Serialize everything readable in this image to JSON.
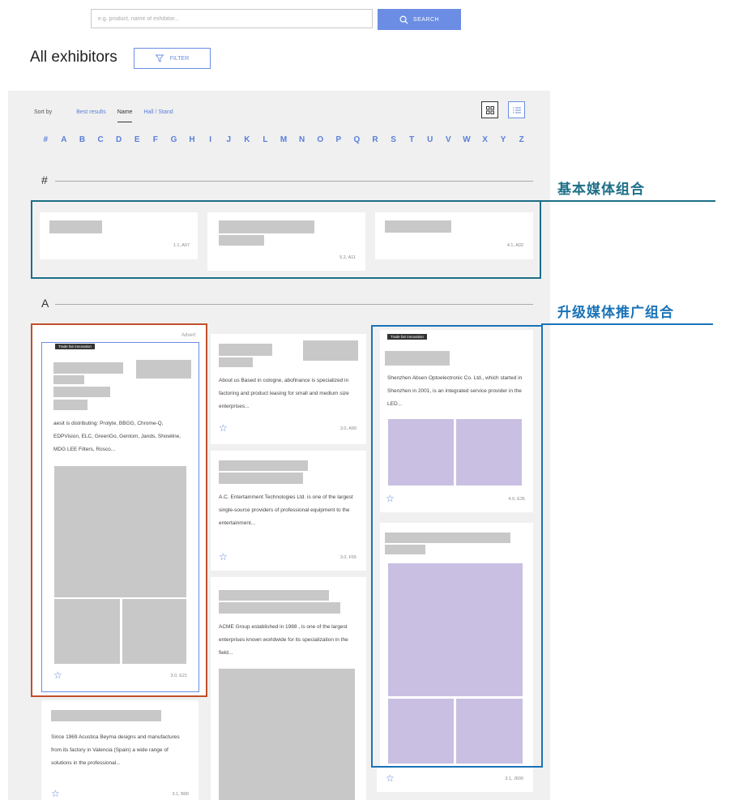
{
  "search": {
    "placeholder": "e.g. product, name of exhibitor...",
    "button_label": "SEARCH"
  },
  "header": {
    "title": "All exhibitors",
    "filter_label": "FILTER"
  },
  "sort": {
    "label": "Sort by",
    "options": [
      "Best results",
      "Name",
      "Hall / Stand"
    ],
    "active": "Name"
  },
  "alphabet": [
    "#",
    "A",
    "B",
    "C",
    "D",
    "E",
    "F",
    "G",
    "H",
    "I",
    "J",
    "K",
    "L",
    "M",
    "N",
    "O",
    "P",
    "Q",
    "R",
    "S",
    "T",
    "U",
    "V",
    "W",
    "X",
    "Y",
    "Z"
  ],
  "sections": {
    "hash": "#",
    "a": "A"
  },
  "annotations": {
    "basic": "基本媒体组合",
    "upgraded": "升级媒体推广组合"
  },
  "hash_cards": [
    {
      "code": "1.1, A07"
    },
    {
      "code": "5.2, A11"
    },
    {
      "code": "4.1, A02"
    }
  ],
  "a_cards": {
    "advert_label": "Advert",
    "tag_label": "Trade fair innovation",
    "card1_desc": "aesit is distributing: Prolyte, BBGG, Chrome-Q, EDPVision, ELC, GreenGo, Gentom, Jands, Showline, MDG LEE Filters, Rosco...",
    "card1_code": "3.0, E21",
    "card2_desc": "About us Based in cologne, abofinance is specialized in factoring and product leasing for small and medium size enterprises...",
    "card2_code": "3.0, A90",
    "card3_desc": "A.C. Entertainment Technologies Ltd. is one of the largest single-source providers of professional equipment to the entertainment...",
    "card3_code": "3.0, F65",
    "card4_desc": "ACME Group established in 1988 , is one of the largest enterprises known worldwide for its specialization in the field...",
    "card5_desc": "Shenzhen Absen Optoelectronic Co. Ltd., which started in Shenzhen in 2001, is an integrated service provider in the LED...",
    "card5_code": "4.0, E35",
    "card6_code": "3.1, J600",
    "card7_desc": "Since 1969 Acustica Beyma designs and manufactures from its factory in Valencia (Spain) a wide range of solutions in the professional...",
    "card7_code": "3.1, B00"
  },
  "colors": {
    "accent": "#6b8de3",
    "teal": "#1e6f87",
    "orange": "#c0502a",
    "purple": "#c9bfe3",
    "blue_frame": "#1a73b8"
  }
}
